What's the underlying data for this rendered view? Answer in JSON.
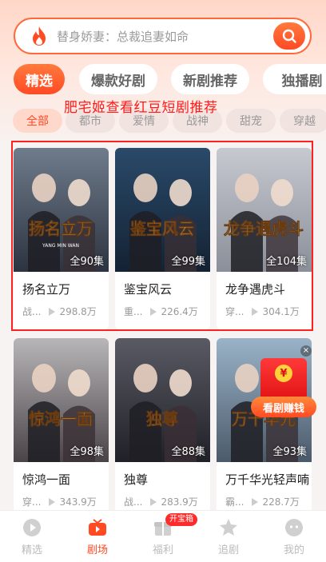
{
  "search": {
    "placeholder": "替身娇妻：总裁追妻如命",
    "icon": "search-icon"
  },
  "tabs": [
    {
      "label": "精选",
      "active": true
    },
    {
      "label": "爆款好剧",
      "active": false
    },
    {
      "label": "新剧推荐",
      "active": false
    },
    {
      "label": "独播剧",
      "active": false
    }
  ],
  "overlay_title": "肥宅姬查看红豆短剧推荐",
  "subtabs": [
    {
      "label": "全部",
      "active": true
    },
    {
      "label": "都市",
      "active": false
    },
    {
      "label": "爱情",
      "active": false
    },
    {
      "label": "战神",
      "active": false
    },
    {
      "label": "甜宠",
      "active": false
    },
    {
      "label": "穿越",
      "active": false
    }
  ],
  "cards": [
    {
      "title": "扬名立万",
      "episodes": "全90集",
      "genre": "战...",
      "views": "298.8万",
      "poster_text": "扬名立万",
      "poster_sub": "YANG  MIN  WAN",
      "palette": [
        "#6f7c8c",
        "#2d3340"
      ]
    },
    {
      "title": "鉴宝风云",
      "episodes": "全99集",
      "genre": "重...",
      "views": "226.4万",
      "poster_text": "鉴宝风云",
      "poster_sub": "",
      "palette": [
        "#2a4a6a",
        "#142233"
      ]
    },
    {
      "title": "龙争遇虎斗",
      "episodes": "全104集",
      "genre": "穿...",
      "views": "304.1万",
      "poster_text": "龙争遇虎斗",
      "poster_sub": "",
      "palette": [
        "#c7c9d0",
        "#8a8f99"
      ]
    },
    {
      "title": "惊鸿一面",
      "episodes": "全98集",
      "genre": "穿...",
      "views": "343.9万",
      "poster_text": "惊鸿一面",
      "poster_sub": "",
      "palette": [
        "#b8b6b8",
        "#4a4347"
      ]
    },
    {
      "title": "独尊",
      "episodes": "全88集",
      "genre": "战...",
      "views": "283.9万",
      "poster_text": "独尊",
      "poster_sub": "",
      "palette": [
        "#5a5a64",
        "#202028"
      ]
    },
    {
      "title": "万千华光轻声喃",
      "episodes": "全93集",
      "genre": "霸...",
      "views": "228.7万",
      "poster_text": "万千华光",
      "poster_sub": "",
      "palette": [
        "#9ab3c8",
        "#4b5a6a"
      ]
    }
  ],
  "promo": {
    "label": "看剧赚钱",
    "coin": "¥"
  },
  "nav": [
    {
      "label": "精选",
      "icon": "play-circle-icon",
      "active": false
    },
    {
      "label": "剧场",
      "icon": "tv-icon",
      "active": true
    },
    {
      "label": "福利",
      "icon": "gift-icon",
      "active": false,
      "badge": "开宝箱"
    },
    {
      "label": "追剧",
      "icon": "star-icon",
      "active": false
    },
    {
      "label": "我的",
      "icon": "user-face-icon",
      "active": false
    }
  ],
  "colors": {
    "accent": "#ff4a24",
    "highlight": "#ff2020"
  }
}
